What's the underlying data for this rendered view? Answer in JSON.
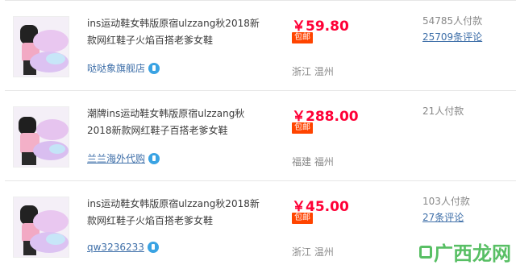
{
  "items": [
    {
      "title": "ins运动鞋女韩版原宿ulzzang秋2018新款网红鞋子火焰百搭老爹女鞋",
      "price": "￥59.80",
      "badge": "包邮",
      "location": "浙江 温州",
      "shop": "哒哒象旗舰店",
      "sales": "54785人付款",
      "reviews": "25709条评论"
    },
    {
      "title": "潮牌ins运动鞋女韩版原宿ulzzang秋2018新款网红鞋子百搭老爹女鞋",
      "price": "￥288.00",
      "badge": "包邮",
      "location": "福建 福州",
      "shop": "兰兰海外代购",
      "sales": "21人付款",
      "reviews": ""
    },
    {
      "title": "ins运动鞋女韩版原宿ulzzang秋2018新款网红鞋子火焰百搭老爹女鞋",
      "price": "￥45.00",
      "badge": "包邮",
      "location": "浙江 温州",
      "shop": "qw3236233",
      "sales": "103人付款",
      "reviews": "27条评论"
    }
  ],
  "watermark": "广西龙网",
  "colors": {
    "price": "#ff0036",
    "badge": "#ff4400",
    "link": "#3d6ea8",
    "muted": "#888888",
    "watermark": "#3cb44a"
  },
  "icons": {
    "shop": "wangwang-chat-icon",
    "watermark": "site-logo-icon"
  }
}
